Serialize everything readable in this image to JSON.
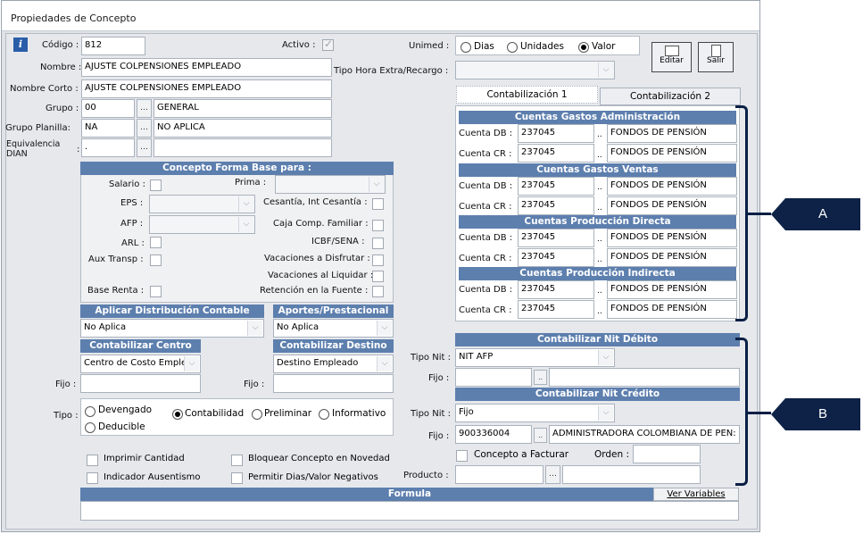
{
  "window": {
    "title": "Propiedades de Concepto"
  },
  "left": {
    "codigo_label": "Código :",
    "codigo": "812",
    "activo_label": "Activo :",
    "nombre_label": "Nombre :",
    "nombre": "AJUSTE COLPENSIONES EMPLEADO",
    "nombre_corto_label": "Nombre Corto :",
    "nombre_corto": "AJUSTE COLPENSIONES EMPLEADO",
    "grupo_label": "Grupo :",
    "grupo": "00",
    "grupo_desc": "GENERAL",
    "grupo_planilla_label": "Grupo Planilla:",
    "grupo_planilla": "NA",
    "grupo_planilla_desc": "NO APLICA",
    "equivalencia_label1": "Equivalencia",
    "equivalencia_label2": "DIAN",
    "equivalencia_colon": ":",
    "equivalencia": "."
  },
  "forma_base": {
    "header": "Concepto Forma Base para :",
    "salario": "Salario :",
    "prima": "Prima :",
    "eps": "EPS :",
    "cesantia": "Cesantía, Int Cesantía :",
    "afp": "AFP :",
    "caja": "Caja Comp. Familiar :",
    "arl": "ARL :",
    "icbf": "ICBF/SENA :",
    "aux_transp": "Aux Transp :",
    "vac_disfrutar": "Vacaciones a Disfrutar :",
    "vac_liquidar": "Vacaciones al Liquidar :",
    "base_renta": "Base Renta :",
    "retencion": "Retención en la Fuente :"
  },
  "distribucion": {
    "header": "Aplicar Distribución Contable",
    "value": "No Aplica"
  },
  "aportes": {
    "header": "Aportes/Prestacional",
    "value": "No Aplica"
  },
  "centro": {
    "header": "Contabilizar Centro",
    "value": "Centro de Costo Emple",
    "fijo_label": "Fijo :"
  },
  "destino": {
    "header": "Contabilizar Destino",
    "value": "Destino Empleado",
    "fijo_label": "Fijo :"
  },
  "tipo": {
    "label": "Tipo :",
    "options": [
      "Devengado",
      "Contabilidad",
      "Preliminar",
      "Informativo",
      "Deducible"
    ],
    "selected": "Contabilidad"
  },
  "flags": {
    "imprimir": "Imprimir Cantidad",
    "bloquear": "Bloquear Concepto en Novedad",
    "ausentismo": "Indicador Ausentismo",
    "permitir": "Permitir Dias/Valor Negativos"
  },
  "formula": {
    "header": "Formula",
    "ver_variables": "Ver Variables"
  },
  "unimed": {
    "label": "Unimed :",
    "options": [
      "Dias",
      "Unidades",
      "Valor"
    ],
    "selected": "Valor"
  },
  "tipo_hora": {
    "label": "Tipo Hora Extra/Recargo :",
    "value": ""
  },
  "buttons": {
    "editar": "Editar",
    "salir": "Salir"
  },
  "tabs": [
    "Contabilización 1",
    "Contabilización 2"
  ],
  "cuentas": [
    {
      "header": "Cuentas Gastos Administración",
      "db_label": "Cuenta DB :",
      "db": "237045",
      "db_desc": "FONDOS DE PENSIÓN",
      "cr_label": "Cuenta CR :",
      "cr": "237045",
      "cr_desc": "FONDOS DE PENSIÓN"
    },
    {
      "header": "Cuentas Gastos Ventas",
      "db_label": "Cuenta DB :",
      "db": "237045",
      "db_desc": "FONDOS DE PENSIÓN",
      "cr_label": "Cuenta CR :",
      "cr": "237045",
      "cr_desc": "FONDOS DE PENSIÓN"
    },
    {
      "header": "Cuentas Producción Directa",
      "db_label": "Cuenta DB :",
      "db": "237045",
      "db_desc": "FONDOS DE PENSIÓN",
      "cr_label": "Cuenta CR :",
      "cr": "237045",
      "cr_desc": "FONDOS DE PENSIÓN"
    },
    {
      "header": "Cuentas Producción Indirecta",
      "db_label": "Cuenta DB :",
      "db": "237045",
      "db_desc": "FONDOS DE PENSIÓN",
      "cr_label": "Cuenta CR :",
      "cr": "237045",
      "cr_desc": "FONDOS DE PENSIÓN"
    }
  ],
  "nit_debito": {
    "header": "Contabilizar Nit Débito",
    "tipo_label": "Tipo Nit :",
    "tipo": "NIT AFP",
    "fijo_label": "Fijo :",
    "fijo": "",
    "fijo_desc": ""
  },
  "nit_credito": {
    "header": "Contabilizar Nit Crédito",
    "tipo_label": "Tipo Nit :",
    "tipo": "Fijo",
    "fijo_label": "Fijo :",
    "fijo": "900336004",
    "fijo_desc": "ADMINISTRADORA COLOMBIANA DE PEN:"
  },
  "concepto_facturar": {
    "label": "Concepto a Facturar",
    "orden_label": "Orden :",
    "orden": "",
    "producto_label": "Producto :"
  },
  "callouts": {
    "a": "A",
    "b": "B"
  },
  "colors": {
    "header_bg": "#5d7fae",
    "callout_bg": "#0d2246"
  }
}
